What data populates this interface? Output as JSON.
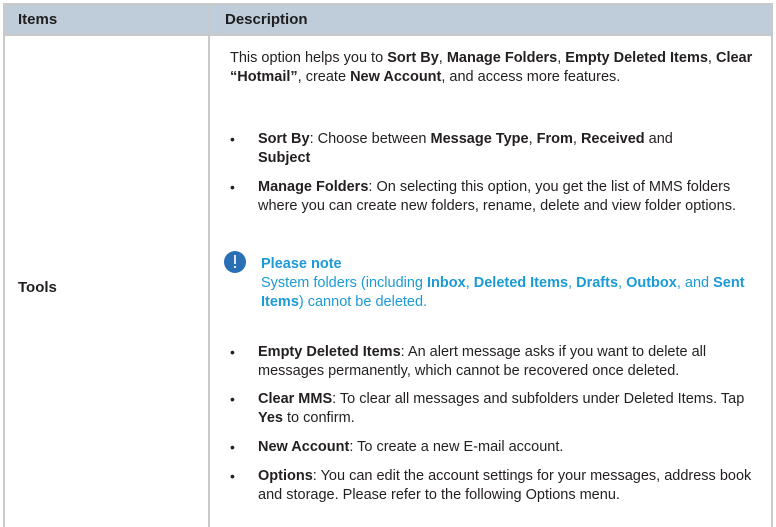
{
  "table": {
    "headers": {
      "items": "Items",
      "description": "Description"
    },
    "row_label": "Tools",
    "intro": {
      "t1": "This option helps you to ",
      "b1": "Sort By",
      "t2": ", ",
      "b2": "Manage Folders",
      "t3": ", ",
      "b3": "Empty Deleted Items",
      "t4": ", ",
      "b4": "Clear “Hotmail”",
      "t5": ", create ",
      "b5": "New Account",
      "t6": ", and access more features."
    },
    "bullet_char": "•",
    "sort_by": {
      "label": "Sort By",
      "t1": ": Choose between ",
      "b1": "Message Type",
      "t2": ", ",
      "b2": "From",
      "t3": ", ",
      "b3": "Received",
      "t4": " and ",
      "b4": "Subject"
    },
    "manage_folders": {
      "label": "Manage Folders",
      "text": ": On selecting this option, you get the list of MMS folders where you can create new folders, rename, delete and view folder options."
    },
    "note": {
      "title": "Please note",
      "t1": "System folders (including ",
      "b1": "Inbox",
      "t2": ", ",
      "b2": "Deleted Items",
      "t3": ", ",
      "b3": "Drafts",
      "t4": ", ",
      "b4": "Outbox",
      "t5": ", and ",
      "b5": "Sent Items",
      "t6": ") cannot be deleted."
    },
    "empty_deleted": {
      "label": "Empty Deleted Items",
      "text": ": An alert message asks if you want to delete all messages permanently, which cannot be recovered once deleted."
    },
    "clear_mms": {
      "label": "Clear MMS",
      "t1": ": To clear all messages and subfolders under Deleted Items. Tap ",
      "b1": "Yes",
      "t2": " to confirm."
    },
    "new_account": {
      "label": "New Account",
      "text": ": To create a new E-mail account."
    },
    "options": {
      "label": "Options",
      "text": ": You can edit the account settings for your messages, address book and storage. Please refer to the following Options menu."
    }
  },
  "colors": {
    "header_bg": "#bfcdda",
    "note_text": "#1c9ad6",
    "note_icon": "#2a6fb5",
    "border": "#c9c9c9"
  },
  "icons": {
    "note": "info-icon"
  }
}
